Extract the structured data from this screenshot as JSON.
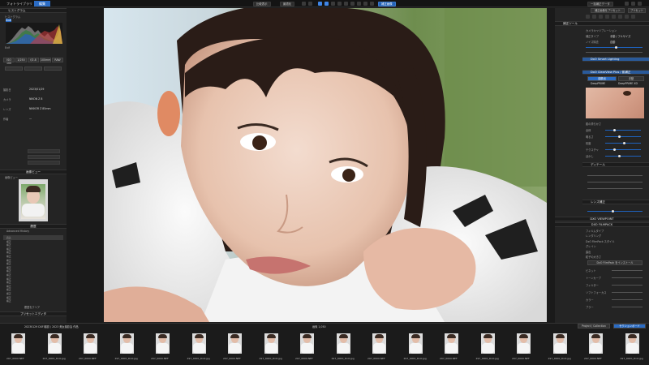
{
  "topbar": {
    "tabs": [
      "フォトライブラリ",
      "編集"
    ],
    "buttons": [
      "比較表示",
      "最適化",
      "書き出し",
      "一括補正データ",
      "設定"
    ],
    "active_tool": "補正画像"
  },
  "left": {
    "histogram_title": "ヒストグラム",
    "histogram_tab": "ヒストグラム",
    "rgb_label": "RGB",
    "exif_title": "Exif",
    "exposure_buttons": [
      "ISO 100",
      "1/250",
      "f/2.8",
      "100mm",
      "RAW"
    ],
    "info_rows": [
      {
        "label": "撮影日",
        "value": "2023/01/29"
      },
      {
        "label": "カメラ",
        "value": "NIKON Z 8"
      },
      {
        "label": "レンズ",
        "value": "NIKKOR Z 85mm"
      },
      {
        "label": "作者",
        "value": "—"
      }
    ],
    "preview_title": "画像ビュー",
    "preview_sub": "画像ビュー",
    "history_title": "履歴",
    "history_head": "Advanced History",
    "history_items": [
      "読込",
      "補正",
      "補正",
      "補正",
      "補正",
      "補正",
      "補正",
      "補正",
      "補正",
      "補正",
      "補正",
      "補正",
      "補正",
      "補正",
      "補正",
      "補正",
      "補正",
      "補正"
    ],
    "history_footer": "履歴をクリア",
    "bottom_head": "プリセットエディタ"
  },
  "right": {
    "header_btn": "補正画像をプリセット",
    "preset_btn": "プリセット",
    "tool_head": "補正ツール",
    "rows": [
      {
        "label": "カメラキャリブレーション"
      },
      {
        "label": "補正タイプ",
        "value": "手動 / フルサイズ"
      },
      {
        "label": "ノイズ除去",
        "value": "自動"
      },
      {
        "label": "ホワイトバランス",
        "value": "—"
      }
    ],
    "section_a": "DxO Smart Lighting",
    "section_b": "DxO ClearView Plus / 肌補正",
    "toggle_a": "顔検出",
    "toggle_b": "手動",
    "toggle_c": "DeepPRIME",
    "toggle_d": "DeepPRIME XD",
    "skin_title": "肌の滑らかさ",
    "slider_labels": [
      "全体",
      "明るさ",
      "彩度",
      "テクスチャ",
      "ぼかし"
    ],
    "sub_heads": [
      "ディテール",
      "レンズ補正",
      "ジオメトリ"
    ],
    "view_section": "DXO VIEWPOINT",
    "film_section": "DXO FILMPACK",
    "film_rows": [
      "フィルムタイプ",
      "レンダリング",
      "DxO FilmPack スタイル",
      "グレイン",
      "露出",
      "粒子の大きさ"
    ],
    "film_button": "DxO FilmPack をインストール",
    "tone_rows": [
      "ビネット",
      "トーンカーブ",
      "フィルター",
      "ソフトフォーカス",
      "カラー",
      "ブラー"
    ]
  },
  "filmstrip": {
    "path": "20230129 DXFI撮影 / 2023 美女撮影会 作品",
    "count_label": "画像 1,050",
    "right_btns": [
      "Project / Collection",
      "セクションボード"
    ],
    "files": [
      "297_0000.NEF",
      "297_0000_DxO.jpg",
      "297_0000.NEF",
      "297_0000_DxO.jpg",
      "297_0000.NEF",
      "297_0000_DxO.jpg",
      "297_0000.NEF",
      "297_0000_DxO.jpg",
      "297_0000.NEF",
      "297_0000_DxO.jpg",
      "297_0000.NEF",
      "297_0000_DxO.jpg",
      "297_0000.NEF",
      "297_0000_DxO.jpg",
      "297_0000.NEF",
      "297_0000_DxO.jpg",
      "297_0000.NEF",
      "297_0000_DxO.jpg"
    ]
  },
  "colors": {
    "accent": "#2b6cc4",
    "panel": "#242424",
    "bg": "#1e1e1e"
  }
}
